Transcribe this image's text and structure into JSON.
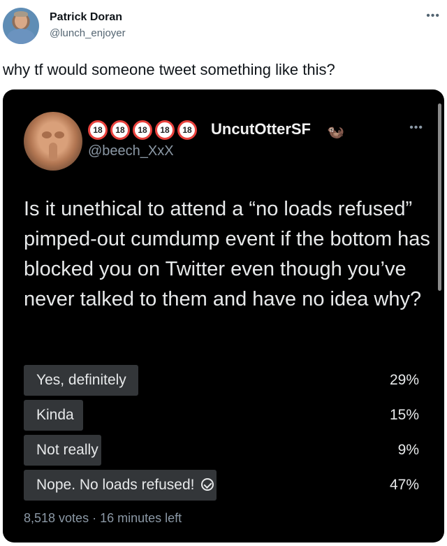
{
  "tweet": {
    "author_name": "Patrick Doran",
    "author_handle": "@lunch_enjoyer",
    "more_icon": "more-icon",
    "text": "why tf would someone tweet something like this?"
  },
  "embedded": {
    "badge_text": "18",
    "badge_count": 5,
    "author_name": "UncutOtterSF",
    "author_handle": "@beech_XxX",
    "question": "Is it unethical to attend a “no loads refused” pimped-out cumdump event if the bottom has blocked you on Twitter even though you’ve never talked to them and have no idea why?",
    "poll": {
      "options": [
        {
          "label": "Yes, definitely",
          "percent_text": "29%",
          "percent": 29,
          "selected": false
        },
        {
          "label": "Kinda",
          "percent_text": "15%",
          "percent": 15,
          "selected": false
        },
        {
          "label": "Not really",
          "percent_text": "9%",
          "percent": 9,
          "selected": false
        },
        {
          "label": "Nope. No loads refused!",
          "percent_text": "47%",
          "percent": 47,
          "selected": true
        }
      ],
      "footer": "8,518 votes · 16 minutes left"
    },
    "colors": {
      "background": "#000000",
      "bar": "#333639",
      "badge_ring": "#e8423d"
    }
  }
}
